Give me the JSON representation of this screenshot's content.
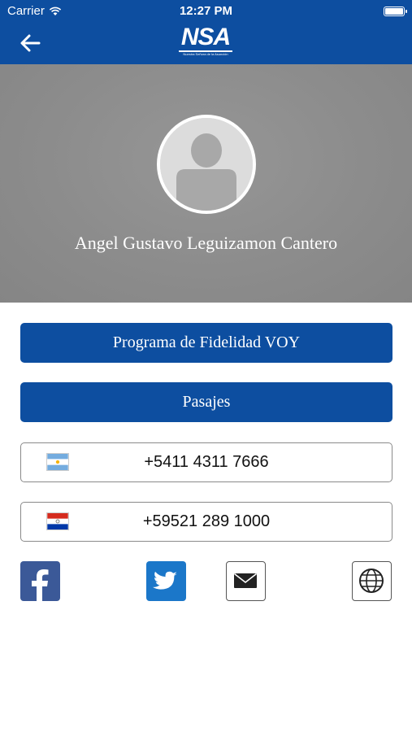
{
  "status_bar": {
    "carrier": "Carrier",
    "time": "12:27 PM"
  },
  "nav": {
    "back_icon": "arrow-left-icon",
    "logo_text": "NSA",
    "logo_tagline": "Nuestra Señora de la Asunción"
  },
  "profile": {
    "avatar_icon": "person-placeholder-icon",
    "name": "Angel Gustavo Leguizamon Cantero"
  },
  "actions": {
    "loyalty_label": "Programa de Fidelidad VOY",
    "tickets_label": "Pasajes"
  },
  "phones": [
    {
      "flag": "argentina-flag-icon",
      "number": "+5411 4311 7666"
    },
    {
      "flag": "paraguay-flag-icon",
      "number": "+59521 289 1000"
    }
  ],
  "social": [
    {
      "icon": "facebook-icon"
    },
    {
      "icon": "twitter-icon"
    },
    {
      "icon": "mail-icon"
    },
    {
      "icon": "globe-icon"
    }
  ],
  "colors": {
    "brand_blue": "#0d4ea0",
    "hero_gray": "#8c8c8c",
    "facebook": "#3b5998",
    "twitter": "#1b77c9"
  }
}
